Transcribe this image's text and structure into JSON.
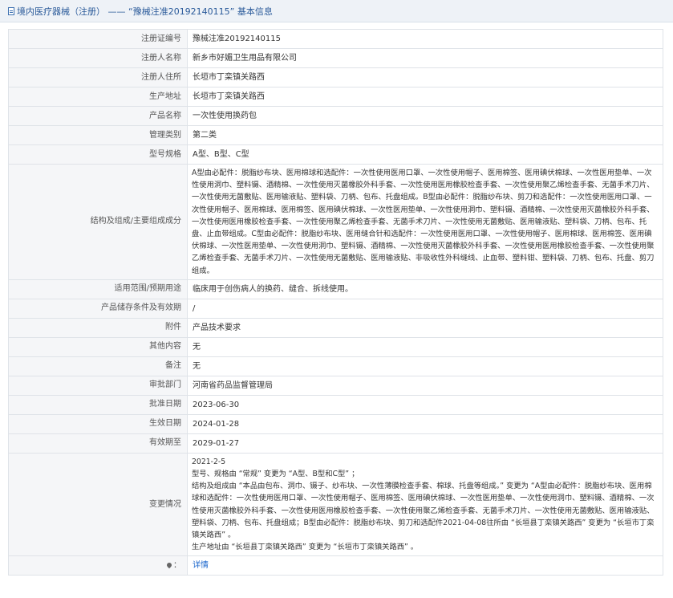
{
  "header": {
    "title": "境内医疗器械（注册） —— “豫械注准20192140115” 基本信息"
  },
  "rows": {
    "reg_no": {
      "label": "注册证编号",
      "value": "豫械注准20192140115"
    },
    "registrant": {
      "label": "注册人名称",
      "value": "新乡市好媚卫生用品有限公司"
    },
    "registrant_addr": {
      "label": "注册人住所",
      "value": "长垣市丁栾镇关路西"
    },
    "prod_addr": {
      "label": "生产地址",
      "value": "长垣市丁栾镇关路西"
    },
    "product_name": {
      "label": "产品名称",
      "value": "一次性使用换药包"
    },
    "mgmt_class": {
      "label": "管理类别",
      "value": "第二类"
    },
    "model_spec": {
      "label": "型号规格",
      "value": "A型、B型、C型"
    },
    "structure": {
      "label": "结构及组成/主要组成成分",
      "value": "A型由必配件：脱脂纱布块、医用棉球和选配件：一次性使用医用口罩、一次性使用帽子、医用棉签、医用碘伏棉球、一次性医用垫单、一次性使用洞巾、塑料镊、酒精棉、一次性使用灭菌橡胶外科手套、一次性使用医用橡胶检查手套、一次性使用聚乙烯检查手套、无菌手术刀片、一次性使用无菌敷贴、医用输液贴、塑料袋、刀柄、包布、托盘组成。B型由必配件：脱脂纱布块、剪刀和选配件：一次性使用医用口罩、一次性使用帽子、医用棉球、医用棉签、医用碘伏棉球、一次性医用垫单、一次性使用洞巾、塑料镊、酒精棉、一次性使用灭菌橡胶外科手套、一次性使用医用橡胶检查手套、一次性使用聚乙烯检查手套、无菌手术刀片、一次性使用无菌敷贴、医用输液贴、塑料袋、刀柄、包布、托盘、止血带组成。C型由必配件：脱脂纱布块、医用缝合针和选配件：一次性使用医用口罩、一次性使用帽子、医用棉球、医用棉签、医用碘伏棉球、一次性医用垫单、一次性使用洞巾、塑料镊、酒精棉、一次性使用灭菌橡胶外科手套、一次性使用医用橡胶检查手套、一次性使用聚乙烯检查手套、无菌手术刀片、一次性使用无菌敷贴、医用输液贴、非吸收性外科缝线、止血带、塑料钳、塑料袋、刀柄、包布、托盘、剪刀组成。"
    },
    "scope": {
      "label": "适用范围/预期用途",
      "value": "临床用于创伤病人的换药、缝合、拆线使用。"
    },
    "storage": {
      "label": "产品储存条件及有效期",
      "value": "/"
    },
    "attachment": {
      "label": "附件",
      "value": "产品技术要求"
    },
    "other": {
      "label": "其他内容",
      "value": "无"
    },
    "remark": {
      "label": "备注",
      "value": "无"
    },
    "approver": {
      "label": "审批部门",
      "value": "河南省药品监督管理局"
    },
    "approval_date": {
      "label": "批准日期",
      "value": "2023-06-30"
    },
    "effective_date": {
      "label": "生效日期",
      "value": "2024-01-28"
    },
    "expiry_date": {
      "label": "有效期至",
      "value": "2029-01-27"
    },
    "changes": {
      "label": "变更情况",
      "lines": [
        "2021-2-5",
        "型号、规格由 “常规” 变更为 “A型、B型和C型” ；",
        "结构及组成由 “本品由包布、洞巾、镊子、纱布块、一次性薄膜检查手套、棉球、托盘等组成。” 变更为 “A型由必配件：脱脂纱布块、医用棉球和选配件：一次性使用医用口罩、一次性使用帽子、医用棉签、医用碘伏棉球、一次性医用垫单、一次性使用洞巾、塑料镊、酒精棉、一次性使用灭菌橡胶外科手套、一次性使用医用橡胶检查手套、一次性使用聚乙烯检查手套、无菌手术刀片、一次性使用无菌敷贴、医用输液贴、塑料袋、刀柄、包布、托盘组成；B型由必配件：脱脂纱布块、剪刀和选配件2021-04-08往所由 “长垣县丁栾镇关路西” 变更为 “长垣市丁栾镇关路西” 。",
        "生产地址由 “长垣县丁栾镇关路西” 变更为 “长垣市丁栾镇关路西” 。"
      ]
    },
    "detail": {
      "label": "详情"
    }
  }
}
